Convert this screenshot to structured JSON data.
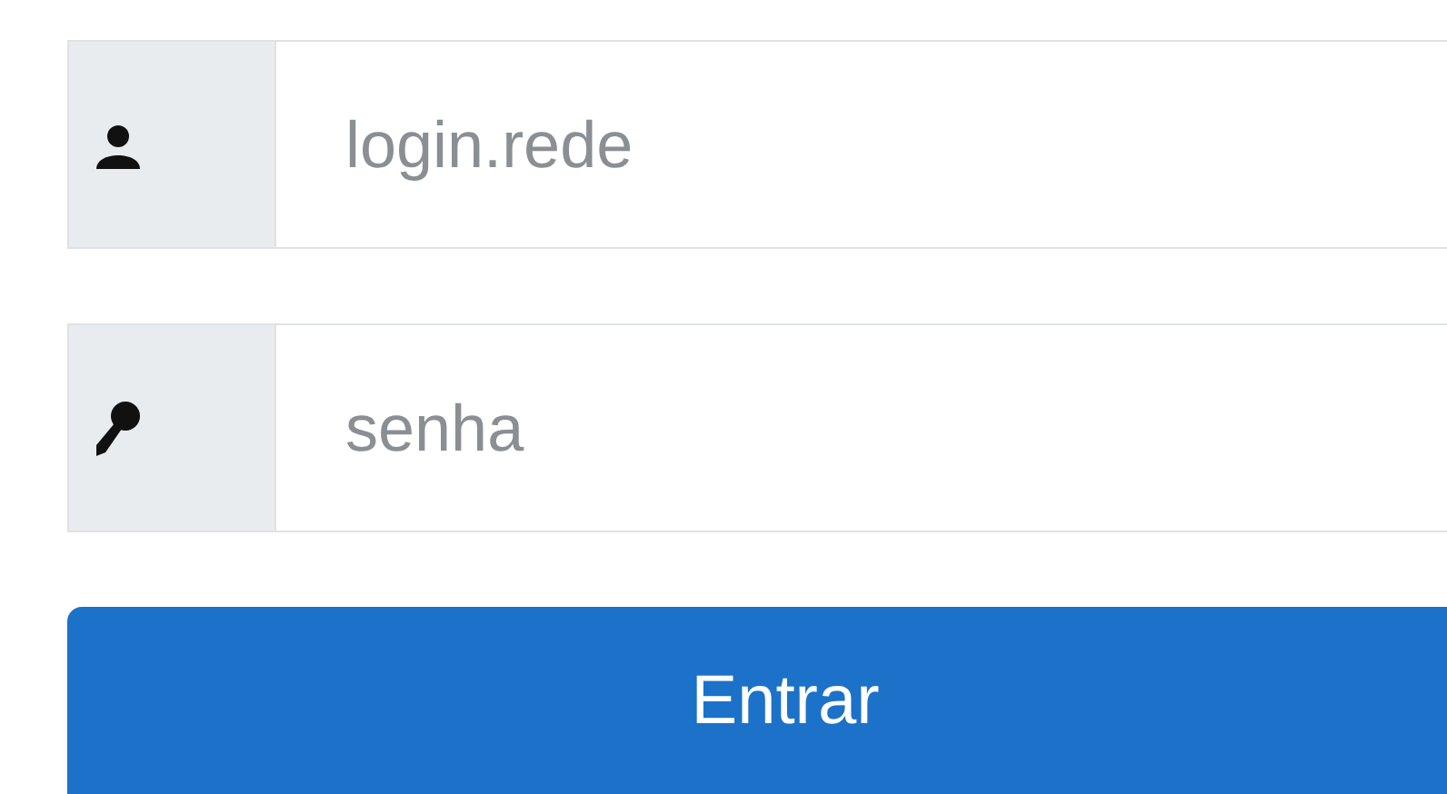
{
  "fields": [
    {
      "kind": "user",
      "placeholder": "login.rede"
    },
    {
      "kind": "key",
      "placeholder": "senha"
    }
  ],
  "submit_button": {
    "label": "Entrar"
  }
}
